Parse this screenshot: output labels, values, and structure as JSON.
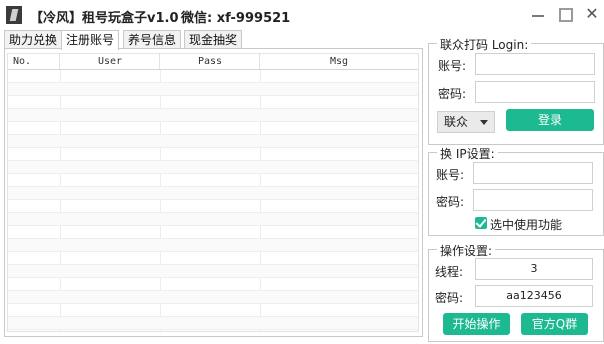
{
  "window": {
    "title": "【冷风】租号玩盒子v1.0",
    "wechat": "微信: xf-999521",
    "close_glyph": "✕"
  },
  "tabs": [
    {
      "label": "助力兑换",
      "active": false
    },
    {
      "label": "注册账号",
      "active": true
    },
    {
      "label": "养号信息",
      "active": false
    },
    {
      "label": "现金抽奖",
      "active": false
    }
  ],
  "table": {
    "columns": [
      "No.",
      "User",
      "Pass",
      "Msg"
    ],
    "rows": []
  },
  "login_group": {
    "title": "联众打码 Login:",
    "account_label": "账号:",
    "account_value": "",
    "password_label": "密码:",
    "password_value": "",
    "platform_selected": "联众",
    "login_button": "登录"
  },
  "ip_group": {
    "title": "换 IP设置:",
    "account_label": "账号:",
    "account_value": "",
    "password_label": "密码:",
    "password_value": "",
    "enable_label": "选中使用功能",
    "enable_checked": true
  },
  "ops_group": {
    "title": "操作设置:",
    "threads_label": "线程:",
    "threads_value": "3",
    "password_label": "密码:",
    "password_value": "aa123456",
    "start_button": "开始操作",
    "qq_group_button": "官方Q群"
  },
  "colors": {
    "accent": "#1db991",
    "border": "#c9c9c9"
  }
}
